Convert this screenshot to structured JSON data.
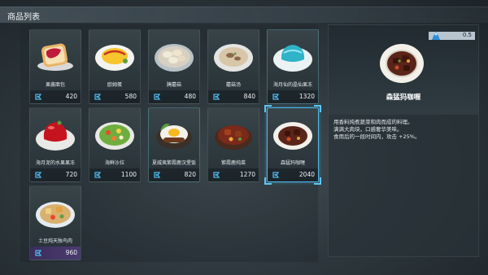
{
  "window": {
    "title": "商品列表"
  },
  "items": [
    {
      "name": "果酱面包",
      "price": "420",
      "dish": "toast-jam-icon",
      "style": "normal"
    },
    {
      "name": "欧姆蛋",
      "price": "580",
      "dish": "omelette-icon",
      "style": "normal"
    },
    {
      "name": "腌蘑菇",
      "price": "480",
      "dish": "pickled-mushroom-icon",
      "style": "normal"
    },
    {
      "name": "蘑菇汤",
      "price": "840",
      "dish": "mushroom-soup-icon",
      "style": "normal"
    },
    {
      "name": "海月仙的晶仙果冻",
      "price": "1320",
      "dish": "blue-jelly-icon",
      "style": "blue"
    },
    {
      "name": "海月泥的水果果冻",
      "price": "720",
      "dish": "red-jelly-icon",
      "style": "normal"
    },
    {
      "name": "海鲜沙拉",
      "price": "1100",
      "dish": "seafood-salad-icon",
      "style": "normal"
    },
    {
      "name": "夏威夷紫霞鹿汉堡饭",
      "price": "820",
      "dish": "loco-moco-icon",
      "style": "blue"
    },
    {
      "name": "紫霞鹿炖菜",
      "price": "1270",
      "dish": "deer-stew-icon",
      "style": "normal"
    },
    {
      "name": "森猛犸咖喱",
      "price": "2040",
      "dish": "mammoth-curry-icon",
      "style": "selected"
    },
    {
      "name": "土豆炖天独鸟肉",
      "price": "960",
      "dish": "potato-stew-icon",
      "style": "purple"
    }
  ],
  "detail": {
    "quantity": "0.5",
    "name": "森猛犸咖喱",
    "description": [
      "用香料炖煮蔬菜和肉而成的料理。",
      "满满大肉块，口感奢华美味。",
      "食用后的一段时间内，攻击 +25%。"
    ]
  }
}
